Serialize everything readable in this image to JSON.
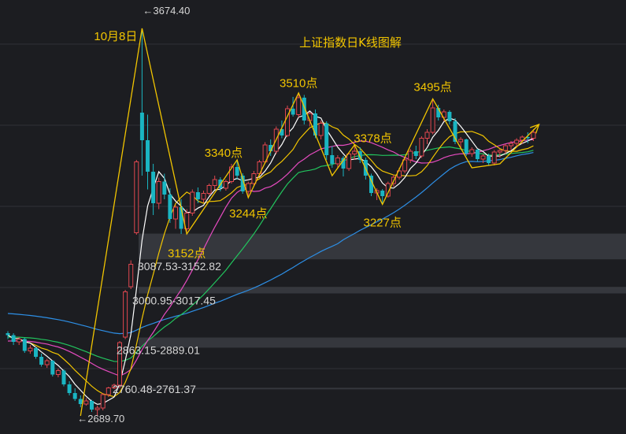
{
  "chart_data": {
    "type": "candlestick",
    "title": "上证指数日K线图解",
    "colors": {
      "background": "#1c1d21",
      "grid": "#2f3136",
      "up": "#e0474f",
      "down": "#1ab5c2",
      "ma5": "#ffffff",
      "ma10": "#f2c500",
      "ma20": "#e64bc0",
      "ma30": "#22c55e",
      "ma60": "#2d8fe6",
      "annotation": "#f2c500",
      "gap_zone": "#3a3c42"
    },
    "ylim": [
      2660,
      3730
    ],
    "extremes": {
      "high_label": "←3674.40",
      "low_label": "←2689.70"
    },
    "annotations": [
      {
        "text": "10月8日",
        "i": 24,
        "v": 3680
      },
      {
        "text": "3510点",
        "i": 52,
        "v": 3525
      },
      {
        "text": "3495点",
        "i": 76,
        "v": 3515
      },
      {
        "text": "3340点",
        "i": 41,
        "v": 3348
      },
      {
        "text": "3378点",
        "i": 63,
        "v": 3385
      },
      {
        "text": "3244点",
        "i": 43,
        "v": 3226
      },
      {
        "text": "3227点",
        "i": 67,
        "v": 3205
      },
      {
        "text": "3152点",
        "i": 32,
        "v": 3133
      }
    ],
    "gaps": [
      {
        "label": "3087.53-3152.82",
        "low": 3087.53,
        "high": 3152.82
      },
      {
        "label": "3000.95-3017.45",
        "low": 3000.95,
        "high": 3017.45
      },
      {
        "label": "2863.15-2889.01",
        "low": 2863.15,
        "high": 2889.01
      },
      {
        "label": "2760.48-2761.37",
        "low": 2760.48,
        "high": 2761.37
      }
    ],
    "wave_path": [
      [
        13,
        2690
      ],
      [
        24,
        3674
      ],
      [
        32,
        3152
      ],
      [
        41,
        3340
      ],
      [
        43,
        3244
      ],
      [
        52,
        3510
      ],
      [
        58,
        3300
      ],
      [
        62,
        3378
      ],
      [
        67,
        3227
      ],
      [
        76,
        3495
      ],
      [
        83,
        3320
      ],
      [
        88,
        3330
      ],
      [
        95,
        3430
      ]
    ],
    "ohlc": [
      [
        2900,
        2905,
        2885,
        2895
      ],
      [
        2895,
        2900,
        2870,
        2878
      ],
      [
        2878,
        2890,
        2870,
        2885
      ],
      [
        2885,
        2888,
        2850,
        2855
      ],
      [
        2855,
        2870,
        2848,
        2862
      ],
      [
        2862,
        2865,
        2835,
        2840
      ],
      [
        2840,
        2848,
        2815,
        2820
      ],
      [
        2820,
        2835,
        2812,
        2830
      ],
      [
        2830,
        2832,
        2790,
        2795
      ],
      [
        2795,
        2810,
        2788,
        2805
      ],
      [
        2805,
        2808,
        2765,
        2770
      ],
      [
        2770,
        2778,
        2742,
        2748
      ],
      [
        2748,
        2760,
        2728,
        2733
      ],
      [
        2733,
        2742,
        2712,
        2720
      ],
      [
        2720,
        2735,
        2716,
        2728
      ],
      [
        2728,
        2731,
        2700,
        2706
      ],
      [
        2706,
        2716,
        2690,
        2710
      ],
      [
        2710,
        2748,
        2704,
        2744
      ],
      [
        2744,
        2764,
        2738,
        2761
      ],
      [
        2761,
        2772,
        2758,
        2768
      ],
      [
        2768,
        2880,
        2760,
        2876
      ],
      [
        2890,
        3010,
        2885,
        3005
      ],
      [
        3018,
        3085,
        3012,
        3075
      ],
      [
        3155,
        3340,
        3150,
        3335
      ],
      [
        3460,
        3674,
        3300,
        3390
      ],
      [
        3390,
        3455,
        3265,
        3310
      ],
      [
        3310,
        3330,
        3200,
        3230
      ],
      [
        3230,
        3295,
        3215,
        3285
      ],
      [
        3285,
        3305,
        3240,
        3252
      ],
      [
        3252,
        3268,
        3180,
        3190
      ],
      [
        3190,
        3225,
        3165,
        3220
      ],
      [
        3220,
        3240,
        3152,
        3165
      ],
      [
        3165,
        3215,
        3158,
        3205
      ],
      [
        3205,
        3265,
        3198,
        3258
      ],
      [
        3258,
        3270,
        3230,
        3240
      ],
      [
        3240,
        3262,
        3232,
        3255
      ],
      [
        3255,
        3280,
        3250,
        3275
      ],
      [
        3275,
        3300,
        3265,
        3290
      ],
      [
        3290,
        3296,
        3260,
        3268
      ],
      [
        3268,
        3290,
        3262,
        3285
      ],
      [
        3285,
        3330,
        3280,
        3322
      ],
      [
        3322,
        3340,
        3290,
        3300
      ],
      [
        3300,
        3306,
        3254,
        3260
      ],
      [
        3260,
        3285,
        3244,
        3280
      ],
      [
        3280,
        3312,
        3272,
        3305
      ],
      [
        3305,
        3340,
        3298,
        3335
      ],
      [
        3335,
        3385,
        3330,
        3378
      ],
      [
        3378,
        3392,
        3350,
        3362
      ],
      [
        3362,
        3425,
        3355,
        3418
      ],
      [
        3418,
        3440,
        3395,
        3402
      ],
      [
        3402,
        3478,
        3398,
        3470
      ],
      [
        3470,
        3500,
        3450,
        3455
      ],
      [
        3455,
        3510,
        3448,
        3498
      ],
      [
        3498,
        3505,
        3430,
        3440
      ],
      [
        3440,
        3462,
        3425,
        3458
      ],
      [
        3458,
        3468,
        3395,
        3402
      ],
      [
        3402,
        3440,
        3392,
        3433
      ],
      [
        3433,
        3438,
        3340,
        3352
      ],
      [
        3352,
        3375,
        3320,
        3330
      ],
      [
        3330,
        3352,
        3318,
        3345
      ],
      [
        3345,
        3350,
        3298,
        3318
      ],
      [
        3318,
        3360,
        3312,
        3355
      ],
      [
        3355,
        3378,
        3340,
        3362
      ],
      [
        3362,
        3372,
        3332,
        3340
      ],
      [
        3340,
        3346,
        3290,
        3300
      ],
      [
        3300,
        3305,
        3248,
        3256
      ],
      [
        3256,
        3268,
        3238,
        3262
      ],
      [
        3262,
        3266,
        3227,
        3248
      ],
      [
        3248,
        3285,
        3244,
        3280
      ],
      [
        3280,
        3302,
        3272,
        3296
      ],
      [
        3296,
        3320,
        3290,
        3312
      ],
      [
        3312,
        3345,
        3306,
        3340
      ],
      [
        3340,
        3368,
        3332,
        3362
      ],
      [
        3362,
        3376,
        3342,
        3350
      ],
      [
        3350,
        3400,
        3345,
        3395
      ],
      [
        3395,
        3418,
        3380,
        3410
      ],
      [
        3410,
        3495,
        3405,
        3472
      ],
      [
        3472,
        3480,
        3440,
        3448
      ],
      [
        3448,
        3468,
        3438,
        3462
      ],
      [
        3462,
        3466,
        3430,
        3438
      ],
      [
        3438,
        3446,
        3380,
        3386
      ],
      [
        3386,
        3398,
        3366,
        3392
      ],
      [
        3392,
        3394,
        3350,
        3356
      ],
      [
        3356,
        3372,
        3348,
        3366
      ],
      [
        3366,
        3368,
        3336,
        3342
      ],
      [
        3342,
        3355,
        3332,
        3350
      ],
      [
        3350,
        3356,
        3325,
        3332
      ],
      [
        3332,
        3365,
        3326,
        3360
      ],
      [
        3360,
        3368,
        3346,
        3364
      ],
      [
        3364,
        3380,
        3355,
        3376
      ],
      [
        3376,
        3388,
        3365,
        3382
      ],
      [
        3382,
        3395,
        3372,
        3390
      ],
      [
        3390,
        3402,
        3380,
        3398
      ],
      [
        3398,
        3410,
        3382,
        3395
      ],
      [
        3395,
        3418,
        3388,
        3410
      ]
    ]
  }
}
